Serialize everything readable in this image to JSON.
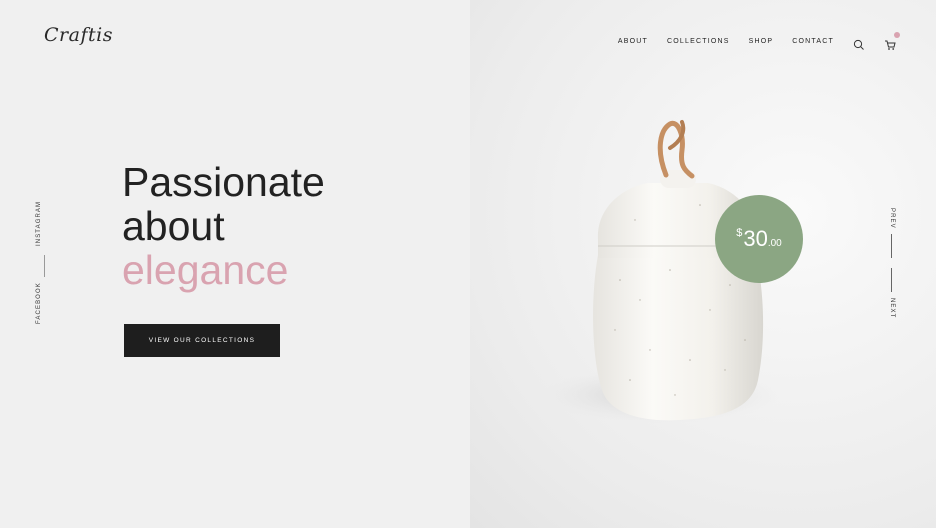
{
  "brand": {
    "logo_text": "Craftis"
  },
  "nav": {
    "items": [
      {
        "label": "ABOUT"
      },
      {
        "label": "COLLECTIONS"
      },
      {
        "label": "SHOP"
      },
      {
        "label": "CONTACT"
      }
    ],
    "search_icon": "search-icon",
    "cart_icon": "cart-icon"
  },
  "social": {
    "instagram": "INSTAGRAM",
    "facebook": "FACEBOOK"
  },
  "hero": {
    "line1": "Passionate",
    "line2": "about",
    "line3": "elegance",
    "cta_label": "VIEW OUR COLLECTIONS"
  },
  "product": {
    "price_currency": "$",
    "price_main": "30",
    "price_cents": ".00"
  },
  "slider": {
    "prev_label": "PREV",
    "next_label": "NEXT"
  },
  "colors": {
    "accent_pink": "#d9a3b0",
    "price_green": "#8ba683",
    "button_dark": "#1e1e1e"
  }
}
